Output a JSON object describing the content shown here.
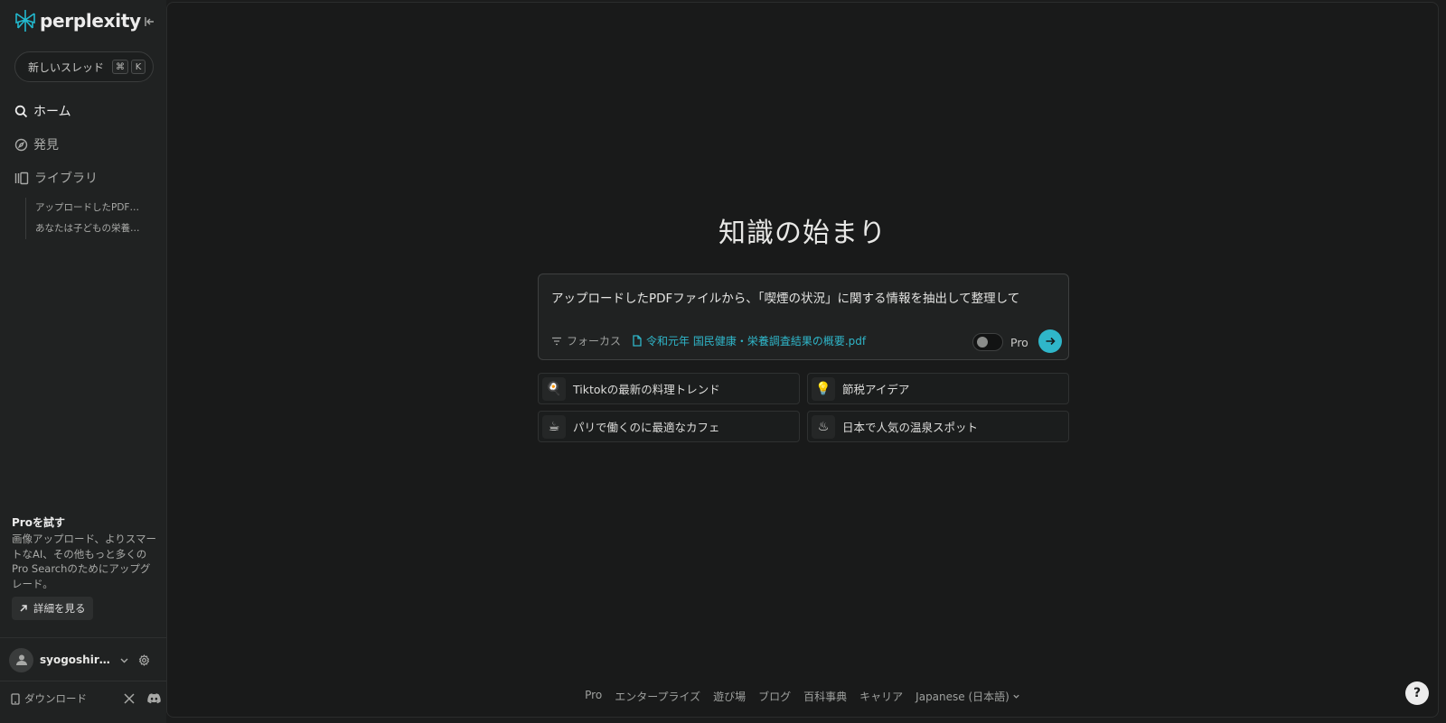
{
  "brand": {
    "name": "perplexity",
    "accent": "#2fb6c9"
  },
  "sidebar": {
    "new_thread": {
      "label": "新しいスレッド",
      "kbd_cmd": "⌘",
      "kbd_key": "K"
    },
    "nav": [
      {
        "label": "ホーム",
        "icon": "search-icon",
        "active": true
      },
      {
        "label": "発見",
        "icon": "compass-icon",
        "active": false
      },
      {
        "label": "ライブラリ",
        "icon": "library-icon",
        "active": false
      }
    ],
    "library_items": [
      "アップロードしたPDFフ...",
      "あなたは子どもの栄養管..."
    ],
    "pro_promo": {
      "title": "Proを試す",
      "description": "画像アップロード、よりスマートなAI、その他もっと多くのPro Searchのためにアップグレード。",
      "button": "詳細を見る"
    },
    "user": {
      "name": "syogoshiro8..."
    },
    "download": "ダウンロード"
  },
  "main": {
    "title": "知識の始まり",
    "search": {
      "value": "アップロードしたPDFファイルから、「喫煙の状況」に関する情報を抽出して整理して",
      "focus_label": "フォーカス",
      "file_name": "令和元年 国民健康・栄養調査結果の概要.pdf",
      "pro_label": "Pro",
      "pro_enabled": false
    },
    "suggestions": [
      {
        "icon": "🍳",
        "text": "Tiktokの最新の料理トレンド"
      },
      {
        "icon": "💡",
        "text": "節税アイデア"
      },
      {
        "icon": "☕",
        "text": "パリで働くのに最適なカフェ"
      },
      {
        "icon": "♨",
        "text": "日本で人気の温泉スポット"
      }
    ],
    "footer_links": [
      "Pro",
      "エンタープライズ",
      "遊び場",
      "ブログ",
      "百科事典",
      "キャリア"
    ],
    "language": "Japanese (日本語)",
    "help_label": "?"
  }
}
